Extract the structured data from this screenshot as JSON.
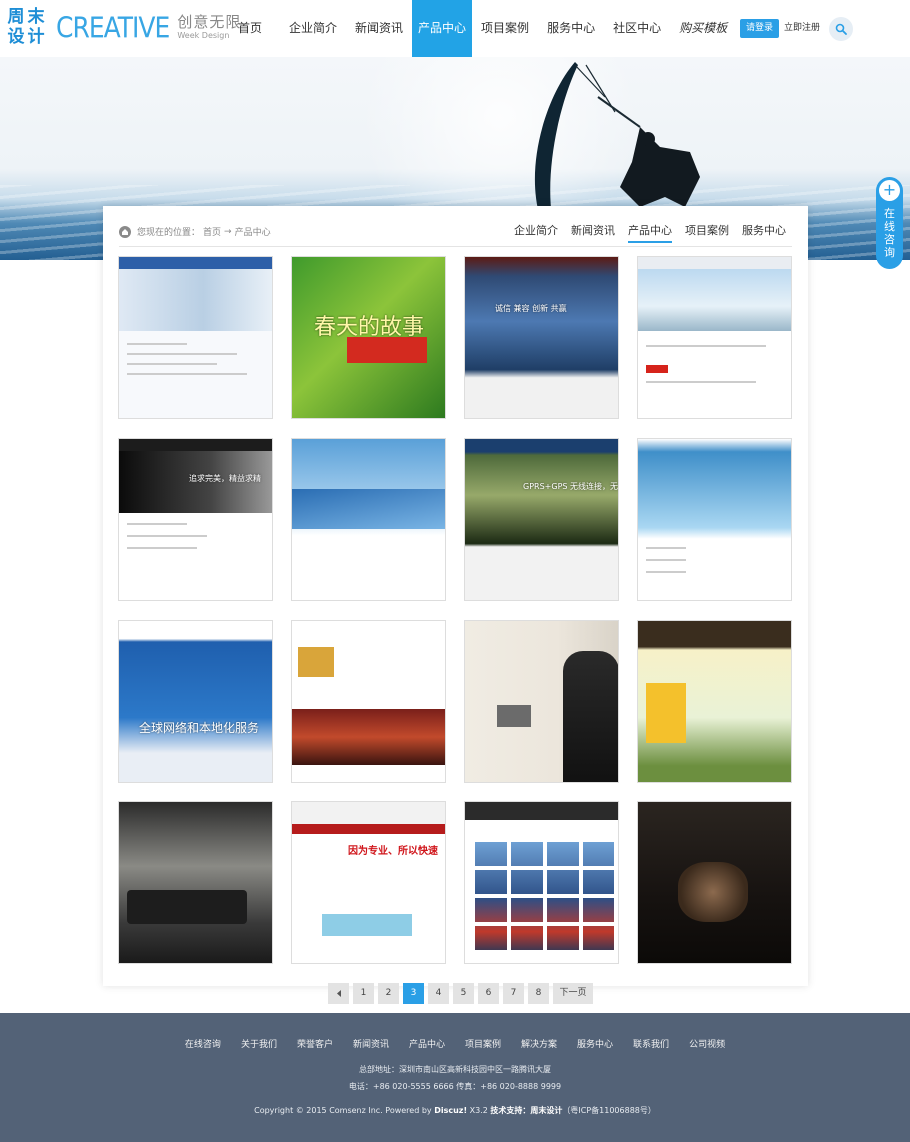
{
  "header": {
    "logo_mark": [
      "周",
      "末",
      "设",
      "计"
    ],
    "logo_creative": "CREATIVE",
    "logo_cn": "创意无限",
    "logo_en": "Week Design",
    "nav": [
      "首页",
      "企业简介",
      "新闻资讯",
      "产品中心",
      "项目案例",
      "服务中心",
      "社区中心",
      "购买模板"
    ],
    "active_nav": "产品中心",
    "login_label": "请登录",
    "register_label": "立即注册"
  },
  "breadcrumb": {
    "label": "您现在的位置：",
    "home": "首页",
    "arrow": "→",
    "current": "产品中心"
  },
  "subnav": [
    "企业简介",
    "新闻资讯",
    "产品中心",
    "项目案例",
    "服务中心"
  ],
  "subnav_active": "产品中心",
  "tiles": [
    {
      "caption": ""
    },
    {
      "caption": "春天的故事"
    },
    {
      "caption": "诚信 兼容 创新 共赢"
    },
    {
      "caption": ""
    },
    {
      "caption": "追求完美，精益求精"
    },
    {
      "caption": ""
    },
    {
      "caption": "GPRS+GPS 无线连接，无盲点"
    },
    {
      "caption": ""
    },
    {
      "caption": "全球网络和本地化服务"
    },
    {
      "caption": ""
    },
    {
      "caption": ""
    },
    {
      "caption": ""
    },
    {
      "caption": ""
    },
    {
      "caption": "因为专业、所以快速"
    },
    {
      "caption": ""
    },
    {
      "caption": ""
    }
  ],
  "pagination": {
    "prev_icon": "triangle-left-icon",
    "pages": [
      "1",
      "2",
      "3",
      "4",
      "5",
      "6",
      "7",
      "8"
    ],
    "current": "3",
    "next_label": "下一页"
  },
  "side_tab": {
    "plus": "+",
    "label": "在线咨询"
  },
  "footer": {
    "links": [
      "在线咨询",
      "关于我们",
      "荣誉客户",
      "新闻资讯",
      "产品中心",
      "项目案例",
      "解决方案",
      "服务中心",
      "联系我们",
      "公司视频"
    ],
    "address": "总部地址：深圳市南山区高新科技园中区一路腾讯大厦",
    "phone": "电话：+86 020-5555 6666  传真：+86 020-8888 9999",
    "copyright_prefix": "Copyright © 2015 Comsenz Inc. Powered by",
    "copyright_brand": "Discuz!",
    "copyright_version": "X3.2",
    "support_label": "技术支持：",
    "support_name": "周末设计",
    "icp": "（粤ICP备11006888号）"
  },
  "colors": {
    "accent": "#22a3e6",
    "footer_bg": "#536277"
  }
}
